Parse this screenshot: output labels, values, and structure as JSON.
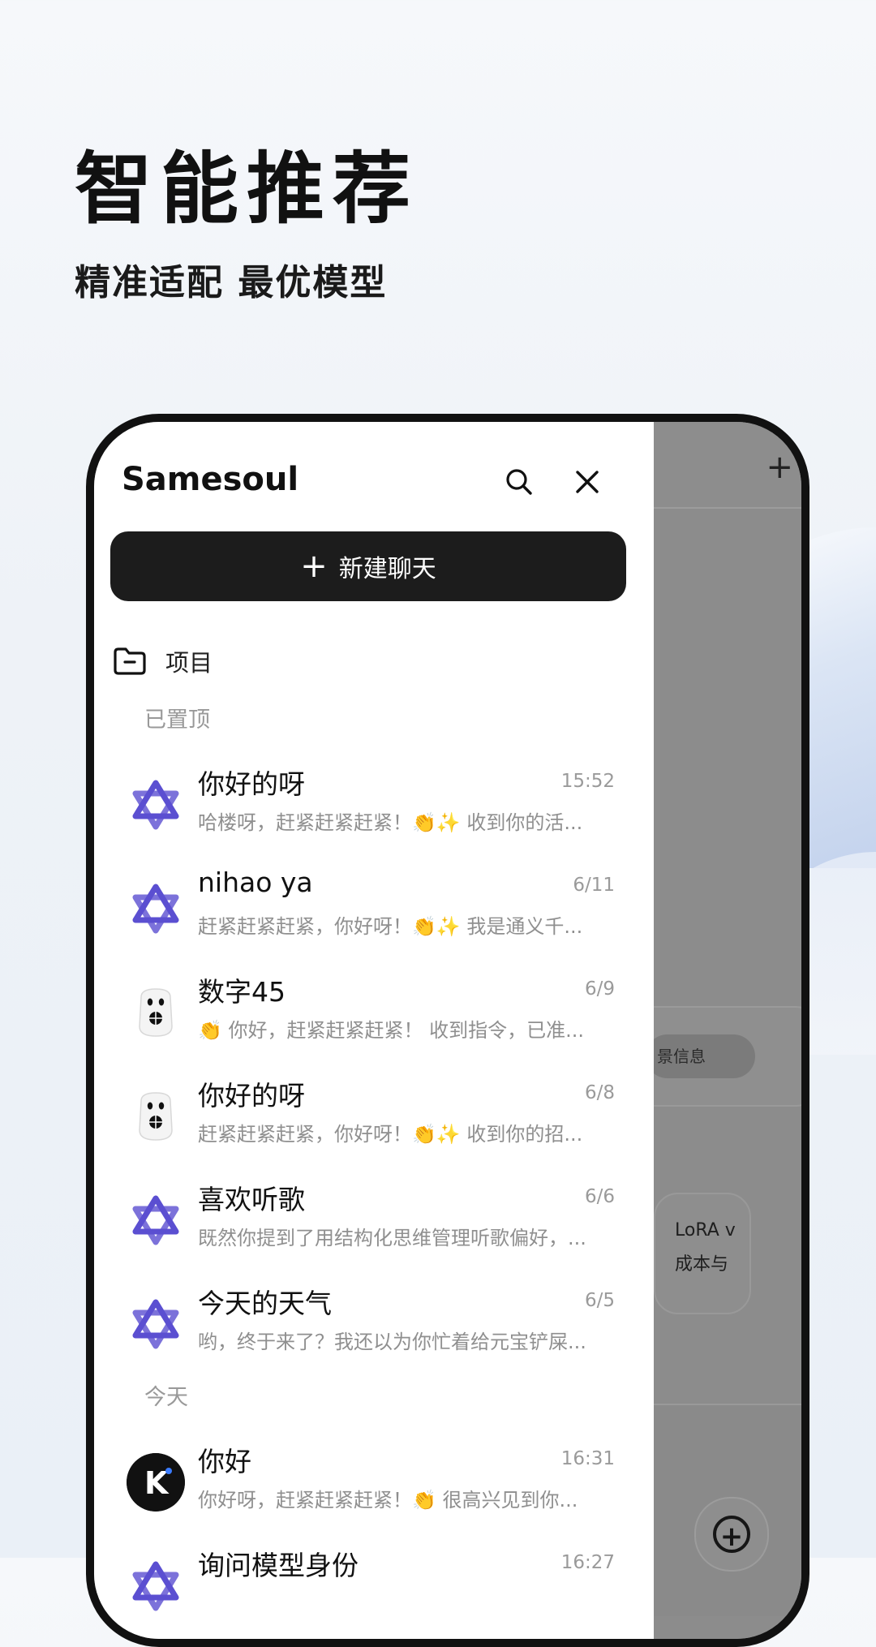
{
  "promo": {
    "headline": "智能推荐",
    "subheadline": "精准适配 最优模型"
  },
  "drawer": {
    "brand": "Samesoul",
    "new_chat_label": "新建聊天",
    "projects_label": "项目",
    "pinned_label": "已置顶",
    "today_label": "今天",
    "pinned": [
      {
        "title": "你好的呀",
        "time": "15:52",
        "preview": "哈楼呀，赶紧赶紧赶紧！👏✨ 收到你的活...",
        "avatar": "star-logo"
      },
      {
        "title": "nihao ya",
        "time": "6/11",
        "preview": "赶紧赶紧赶紧，你好呀！👏✨ 我是通义千...",
        "avatar": "star-logo"
      },
      {
        "title": "数字45",
        "time": "6/9",
        "preview": "👏 你好，赶紧赶紧赶紧！ 收到指令，已准...",
        "avatar": "robot-logo"
      },
      {
        "title": "你好的呀",
        "time": "6/8",
        "preview": "赶紧赶紧赶紧，你好呀！👏✨ 收到你的招...",
        "avatar": "robot-logo"
      },
      {
        "title": "喜欢听歌",
        "time": "6/6",
        "preview": "既然你提到了用结构化思维管理听歌偏好，...",
        "avatar": "star-logo"
      },
      {
        "title": "今天的天气",
        "time": "6/5",
        "preview": "哟，终于来了？我还以为你忙着给元宝铲屎...",
        "avatar": "star-logo"
      }
    ],
    "today": [
      {
        "title": "你好",
        "time": "16:31",
        "preview": "你好呀，赶紧赶紧赶紧！👏 很高兴见到你...",
        "avatar": "k-logo"
      },
      {
        "title": "询问模型身份",
        "time": "16:27",
        "preview": "",
        "avatar": "star-logo"
      }
    ]
  },
  "background_screen": {
    "plus_label": "+",
    "chip_text": "景信息",
    "card_line1": "LoRA v",
    "card_line2": "成本与"
  },
  "colors": {
    "accent_dark": "#1c1c1c",
    "star_logo": "#5b4fd1"
  }
}
